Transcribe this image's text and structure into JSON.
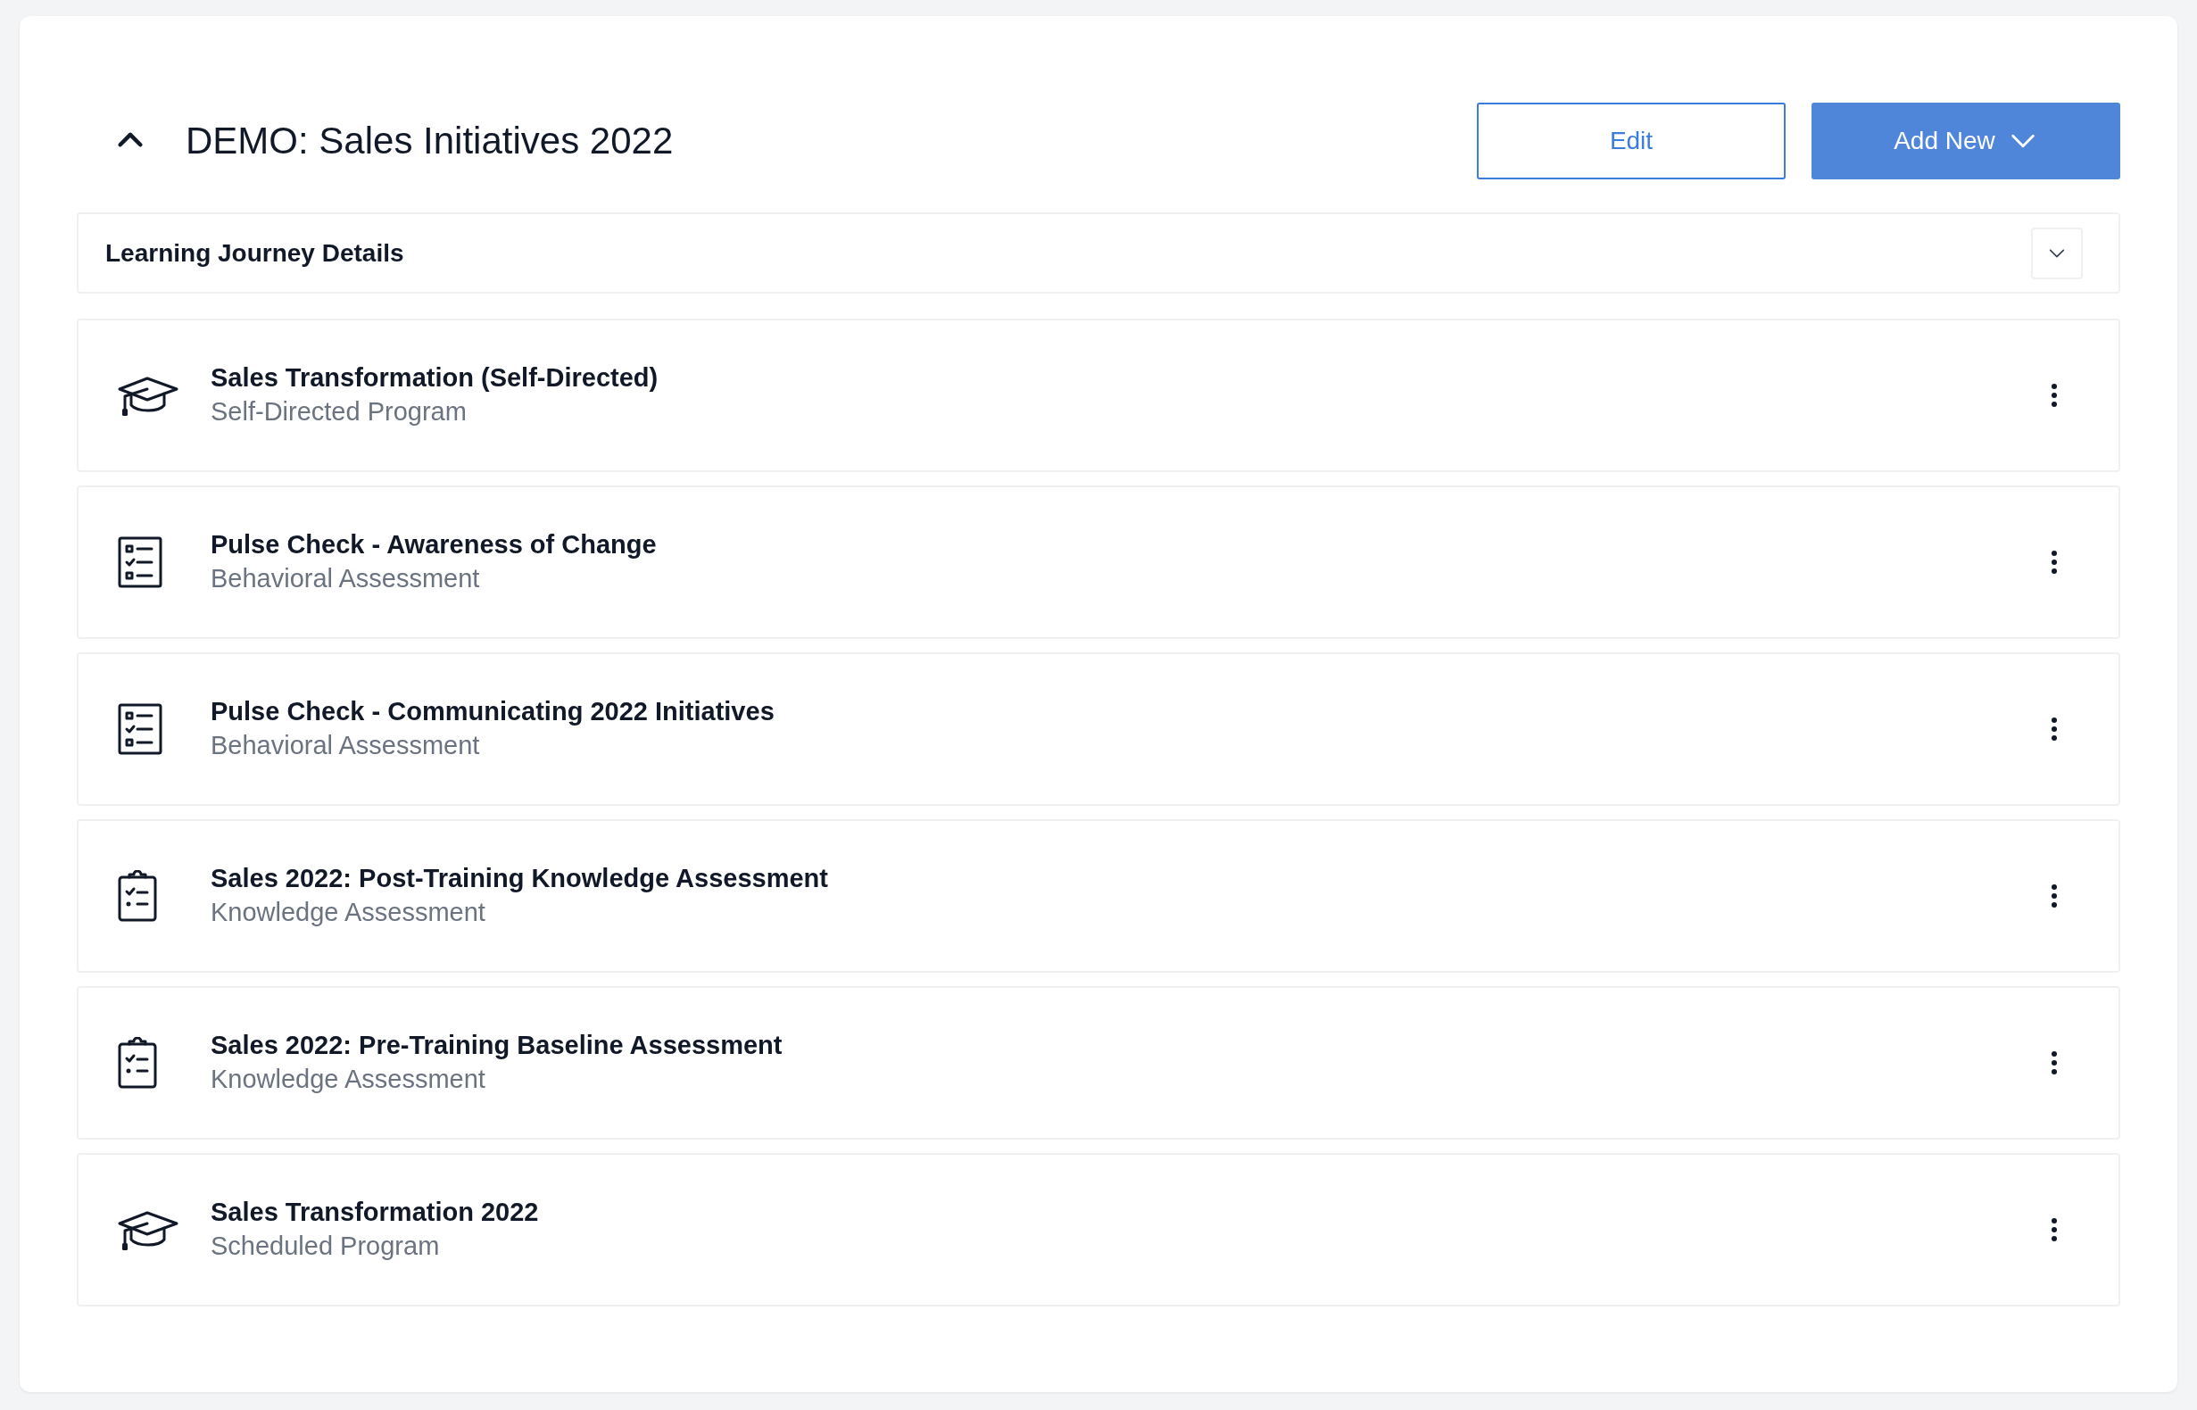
{
  "journey": {
    "title": "DEMO: Sales Initiatives 2022",
    "expanded": true
  },
  "actions": {
    "edit": "Edit",
    "add_new": "Add New"
  },
  "details": {
    "label": "Learning Journey Details",
    "expanded": false
  },
  "items": [
    {
      "kind": "program",
      "title": "Sales Transformation (Self-Directed)",
      "subtitle": "Self-Directed Program"
    },
    {
      "kind": "checklist",
      "title": "Pulse Check - Awareness of Change",
      "subtitle": "Behavioral Assessment"
    },
    {
      "kind": "checklist",
      "title": "Pulse Check - Communicating 2022 Initiatives",
      "subtitle": "Behavioral Assessment"
    },
    {
      "kind": "clipboard",
      "title": "Sales 2022: Post-Training Knowledge Assessment",
      "subtitle": "Knowledge Assessment"
    },
    {
      "kind": "clipboard",
      "title": "Sales 2022: Pre-Training Baseline Assessment",
      "subtitle": "Knowledge Assessment"
    },
    {
      "kind": "program",
      "title": "Sales Transformation 2022",
      "subtitle": "Scheduled Program"
    }
  ]
}
